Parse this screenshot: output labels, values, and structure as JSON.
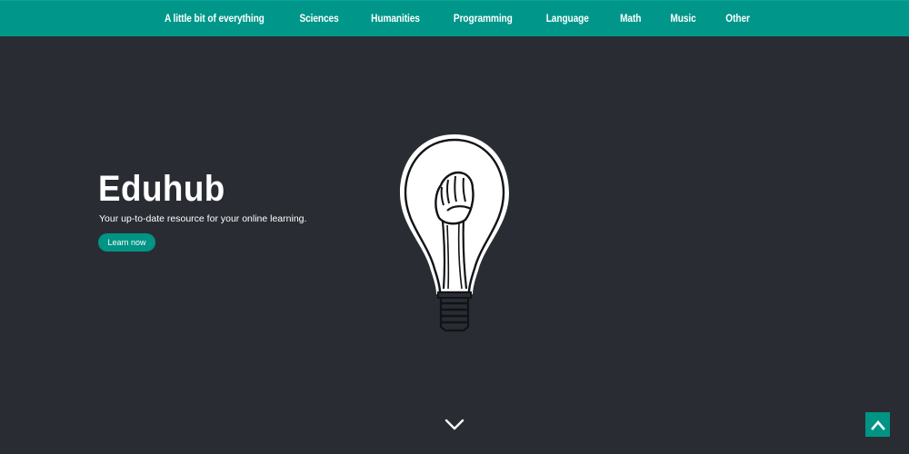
{
  "nav": {
    "items": [
      {
        "label": "A little bit of everything"
      },
      {
        "label": "Sciences"
      },
      {
        "label": "Humanities"
      },
      {
        "label": "Programming"
      },
      {
        "label": "Language"
      },
      {
        "label": "Math"
      },
      {
        "label": "Music"
      },
      {
        "label": "Other"
      }
    ]
  },
  "hero": {
    "title": "Eduhub",
    "subtitle": "Your up-to-date resource for your online learning.",
    "cta_label": "Learn now",
    "illustration_icon": "lightbulb-fist-icon"
  },
  "controls": {
    "scroll_down_icon": "chevron-down-icon",
    "back_to_top_icon": "chevron-up-icon"
  },
  "colors": {
    "accent": "#00978a",
    "background": "#292d33",
    "text": "#ffffff"
  }
}
